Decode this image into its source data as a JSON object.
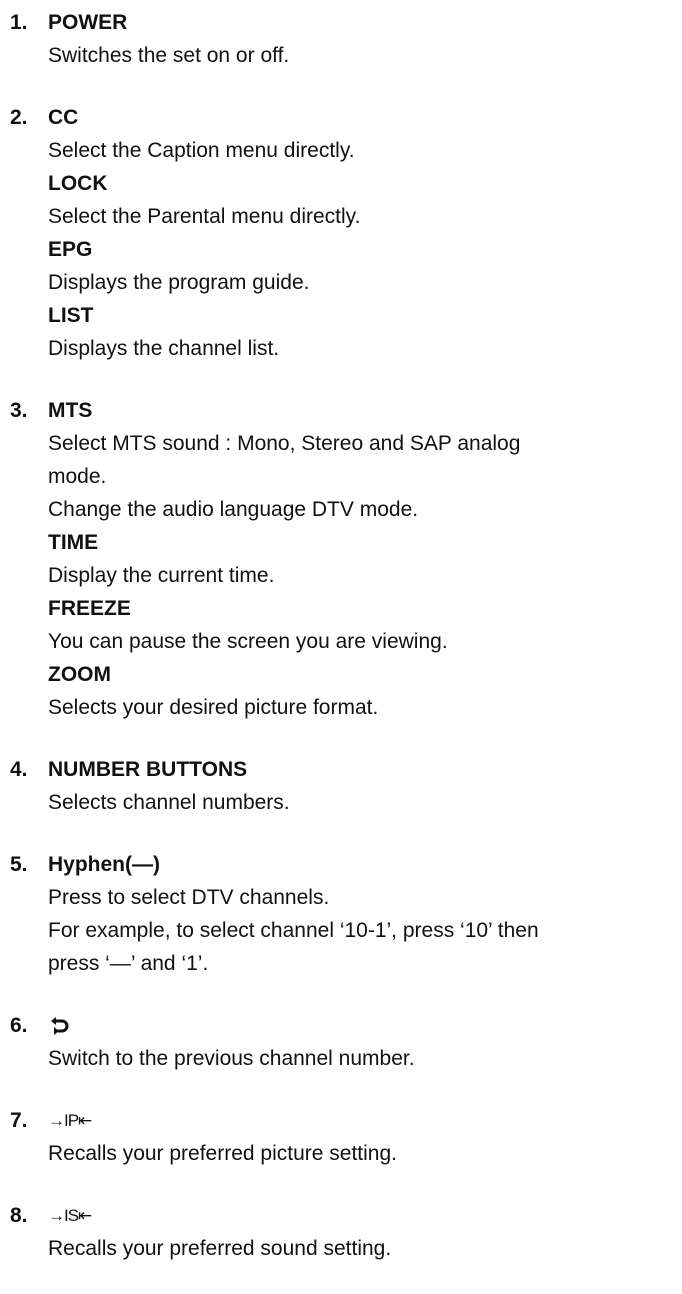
{
  "items": [
    {
      "num": "1.",
      "title": "POWER",
      "lines": [
        "Switches the set on or off."
      ]
    },
    {
      "num": "2.",
      "title": "CC",
      "lines": [
        "Select the Caption menu directly."
      ],
      "subs": [
        {
          "title": "LOCK",
          "lines": [
            "Select the Parental menu directly."
          ]
        },
        {
          "title": "EPG",
          "lines": [
            "Displays the program guide."
          ]
        },
        {
          "title": "LIST",
          "lines": [
            "Displays the channel list."
          ]
        }
      ]
    },
    {
      "num": "3.",
      "title": "MTS",
      "lines": [
        "Select MTS sound : Mono, Stereo and SAP analog",
        "mode.",
        "Change the audio language DTV mode."
      ],
      "subs": [
        {
          "title": "TIME",
          "lines": [
            "Display the current time."
          ]
        },
        {
          "title": "FREEZE",
          "lines": [
            "You can pause the screen you are viewing."
          ]
        },
        {
          "title": "ZOOM",
          "lines": [
            "Selects your desired picture format."
          ]
        }
      ]
    },
    {
      "num": "4.",
      "title": "NUMBER BUTTONS",
      "lines": [
        "Selects channel numbers."
      ]
    },
    {
      "num": "5.",
      "title": "Hyphen(—)",
      "lines": [
        "Press to select DTV channels.",
        "For example, to select channel ‘10-1’, press ‘10’ then",
        "press ‘—’ and ‘1’."
      ]
    },
    {
      "num": "6.",
      "icon": "previous-channel-icon",
      "lines": [
        "Switch to the previous channel number."
      ]
    },
    {
      "num": "7.",
      "title": "→IP⇤",
      "lines": [
        "Recalls your preferred picture setting."
      ]
    },
    {
      "num": "8.",
      "title": "→IS⇤",
      "lines": [
        "Recalls your preferred sound setting."
      ]
    }
  ]
}
